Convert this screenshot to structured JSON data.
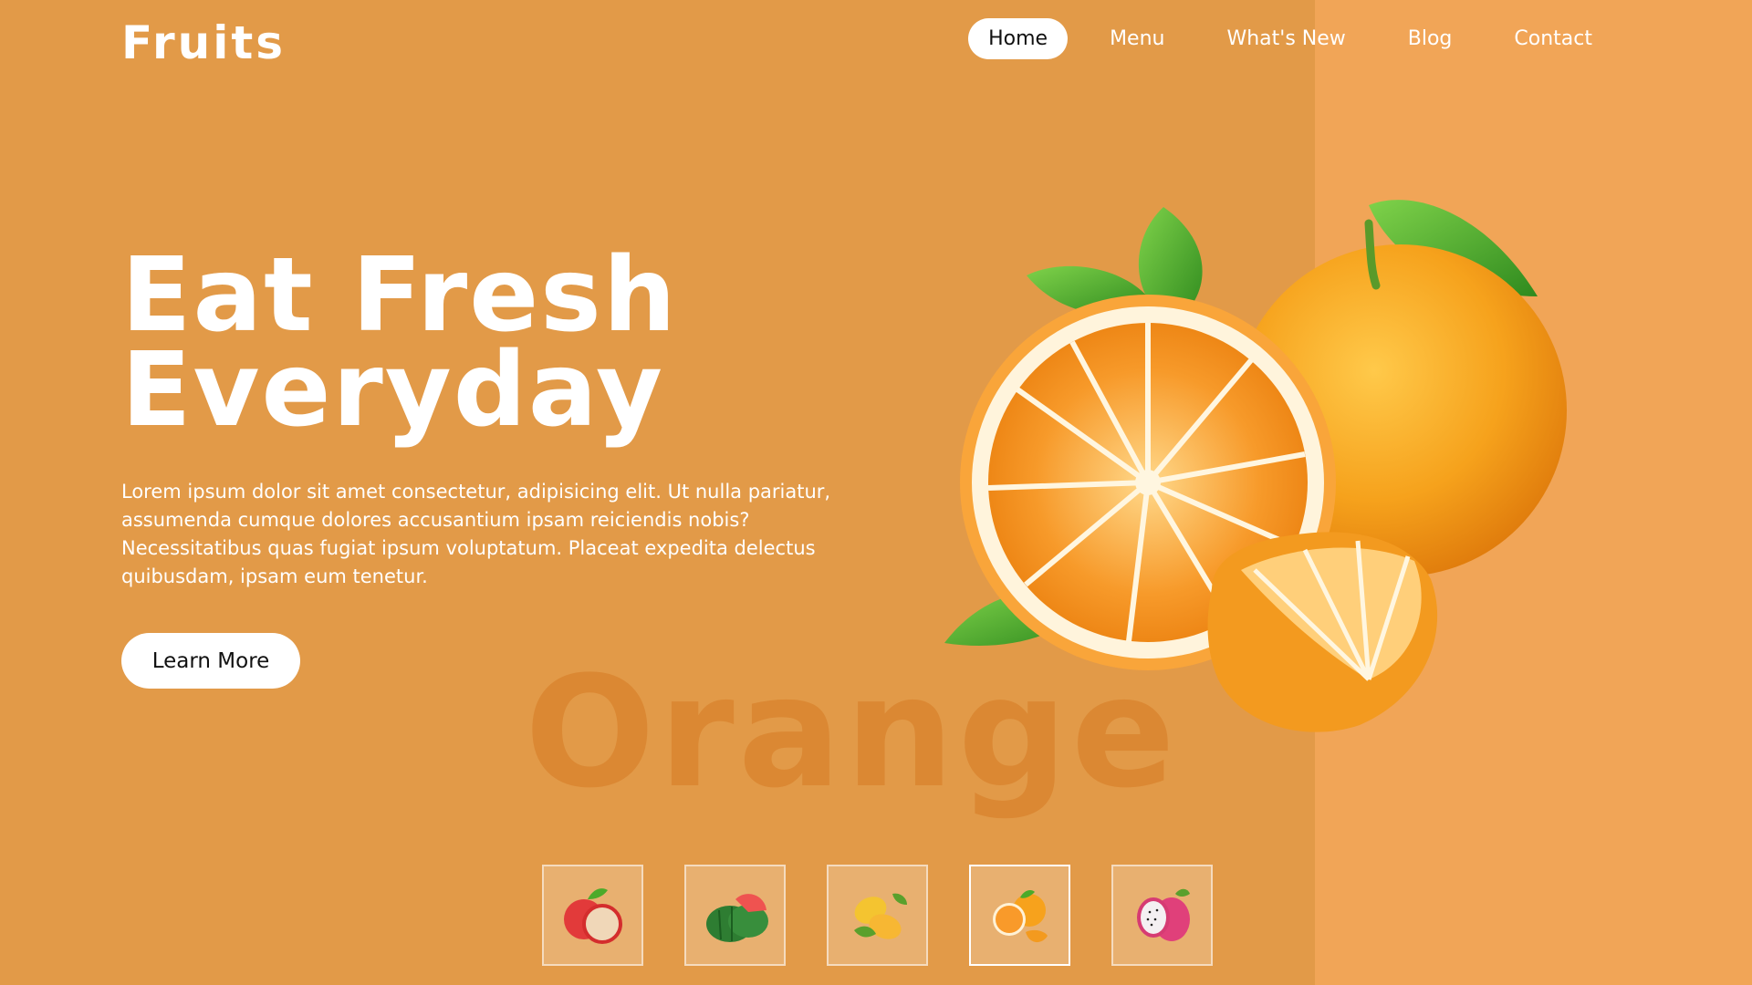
{
  "brand": {
    "logo": "Fruits"
  },
  "nav": {
    "items": [
      {
        "label": "Home",
        "active": true
      },
      {
        "label": "Menu",
        "active": false
      },
      {
        "label": "What's New",
        "active": false
      },
      {
        "label": "Blog",
        "active": false
      },
      {
        "label": "Contact",
        "active": false
      }
    ]
  },
  "hero": {
    "title_line1": "Eat Fresh",
    "title_line2": "Everyday",
    "description": "Lorem ipsum dolor sit amet consectetur, adipisicing elit. Ut nulla pariatur, assumenda cumque dolores accusantium ipsam reiciendis nobis? Necessitatibus quas fugiat ipsum voluptatum. Placeat expedita delectus quibusdam, ipsam eum tenetur.",
    "button_label": "Learn More",
    "watermark": "Orange",
    "image_icon": "orange-fruit-illustration"
  },
  "thumbnails": [
    {
      "icon": "apple-icon",
      "active": false
    },
    {
      "icon": "watermelon-icon",
      "active": false
    },
    {
      "icon": "mango-icon",
      "active": false
    },
    {
      "icon": "orange-icon",
      "active": true
    },
    {
      "icon": "dragonfruit-icon",
      "active": false
    }
  ],
  "colors": {
    "background": "#e29a48",
    "right_panel": "#f1a557",
    "watermark": "#d9832d",
    "text": "#ffffff",
    "button_bg": "#ffffff"
  }
}
